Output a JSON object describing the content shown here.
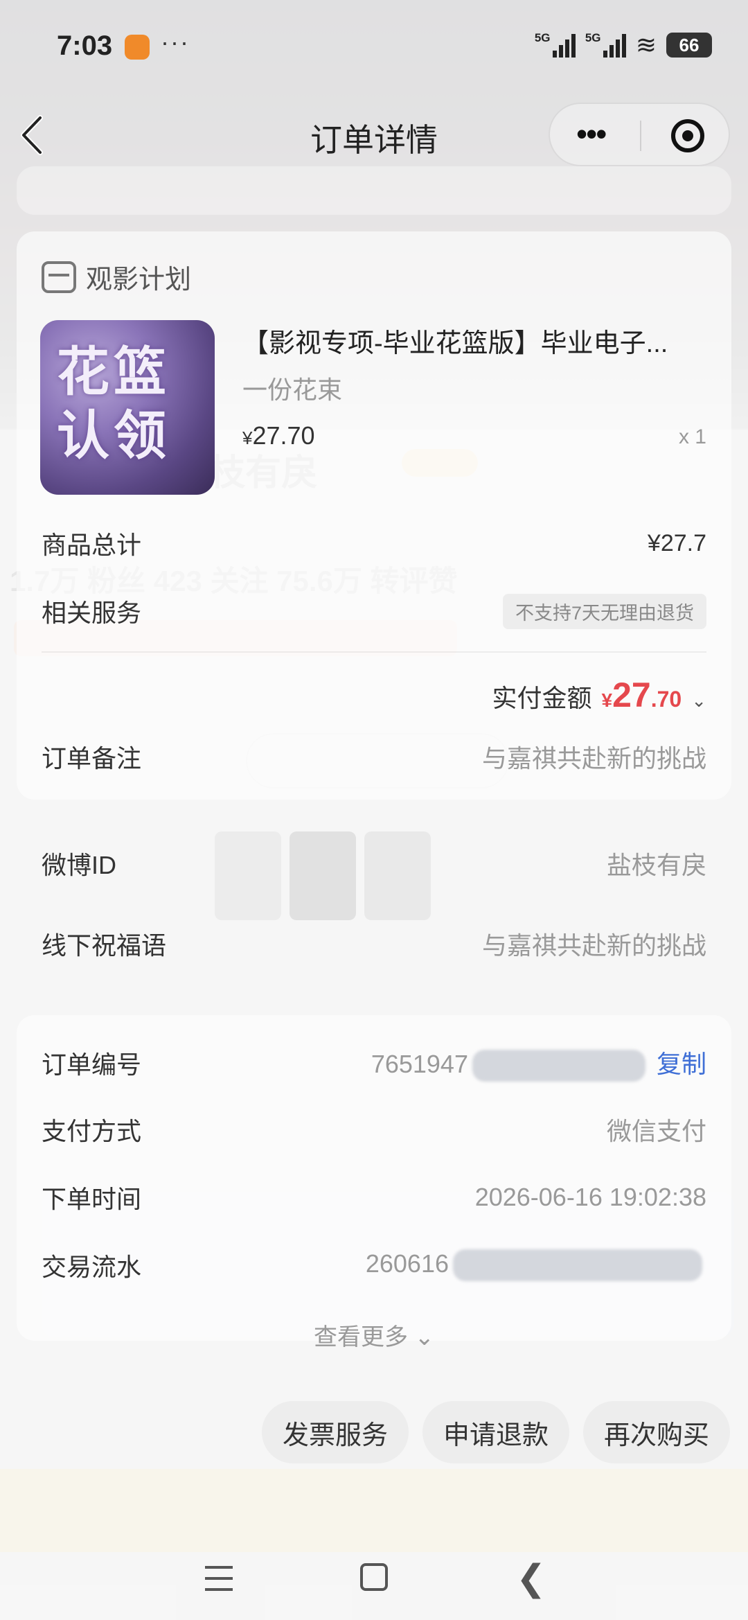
{
  "status_bar": {
    "time": "7:03",
    "dots": "···",
    "sim1": "5G",
    "sim2": "5G",
    "battery": "66"
  },
  "header": {
    "title": "订单详情"
  },
  "plan": {
    "label": "观影计划"
  },
  "product": {
    "thumb_text": "花篮 认领",
    "title": "【影视专项-毕业花篮版】毕业电子...",
    "subtitle": "一份花束",
    "price_symbol": "¥",
    "price": "27.70",
    "quantity": "x 1"
  },
  "summary": {
    "total_label": "商品总计",
    "total_value": "¥27.7",
    "service_label": "相关服务",
    "service_tag": "不支持7天无理由退货",
    "paid_label": "实付金额",
    "paid_symbol": "¥",
    "paid_int": "27",
    "paid_dec": ".70",
    "remark_label": "订单备注",
    "remark_value": "与嘉祺共赴新的挑战",
    "weibo_label": "微博ID",
    "weibo_value": "盐枝有戾",
    "wish_label": "线下祝福语",
    "wish_value": "与嘉祺共赴新的挑战"
  },
  "order_info": {
    "order_no_label": "订单编号",
    "order_no_prefix": "7651947",
    "copy_label": "复制",
    "pay_method_label": "支付方式",
    "pay_method_value": "微信支付",
    "order_time_label": "下单时间",
    "order_time_value": "2026-06-16 19:02:38",
    "serial_label": "交易流水",
    "serial_prefix": "260616",
    "see_more": "查看更多"
  },
  "actions": {
    "invoice": "发票服务",
    "refund": "申请退款",
    "rebuy": "再次购买"
  },
  "background": {
    "name": "盐枝有戾",
    "stats": "1.7万 粉丝   423 关注   75.6万 转评赞"
  }
}
